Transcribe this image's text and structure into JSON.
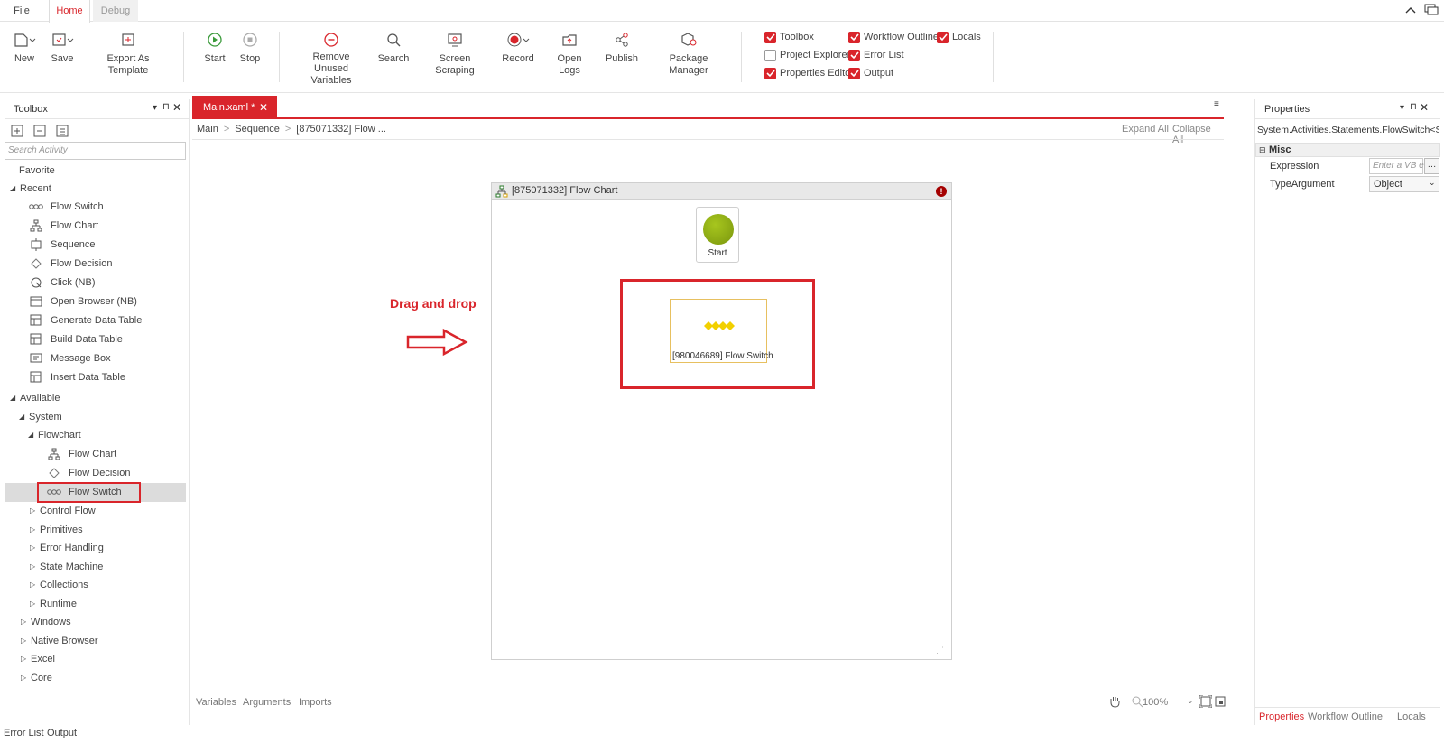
{
  "menu": {
    "tabs": [
      "File",
      "Home",
      "Debug"
    ]
  },
  "ribbon": {
    "buttons": {
      "new": "New",
      "save": "Save",
      "export": "Export As Template",
      "start": "Start",
      "stop": "Stop",
      "remove_unused_line1": "Remove Unused",
      "remove_unused_line2": "Variables",
      "search": "Search",
      "screen_scraping": "Screen Scraping",
      "record": "Record",
      "open_logs": "Open Logs",
      "publish": "Publish",
      "package_manager": "Package Manager"
    },
    "checks": [
      {
        "label": "Toolbox",
        "checked": true
      },
      {
        "label": "Workflow Outline",
        "checked": true
      },
      {
        "label": "Locals",
        "checked": true
      },
      {
        "label": "Project Explorer",
        "checked": false
      },
      {
        "label": "Error List",
        "checked": true
      },
      {
        "label": "Properties Editor",
        "checked": true
      },
      {
        "label": "Output",
        "checked": true
      }
    ]
  },
  "toolbox": {
    "title": "Toolbox",
    "search_placeholder": "Search Activity",
    "favorite": "Favorite",
    "recent": "Recent",
    "recent_items": [
      "Flow Switch",
      "Flow Chart",
      "Sequence",
      "Flow Decision",
      "Click (NB)",
      "Open Browser (NB)",
      "Generate Data Table",
      "Build Data Table",
      "Message Box",
      "Insert Data Table"
    ],
    "available": "Available",
    "system": "System",
    "flowchart": "Flowchart",
    "flowchart_items": [
      "Flow Chart",
      "Flow Decision",
      "Flow Switch"
    ],
    "system_groups": [
      "Control Flow",
      "Primitives",
      "Error Handling",
      "State Machine",
      "Collections",
      "Runtime"
    ],
    "top_groups": [
      "Windows",
      "Native Browser",
      "Excel",
      "Core"
    ]
  },
  "designer": {
    "tab_label": "Main.xaml *",
    "breadcrumb": [
      "Main",
      "Sequence",
      "[875071332] Flow ..."
    ],
    "expand_all": "Expand All",
    "collapse_all": "Collapse All",
    "flowchart_title": "[875071332] Flow Chart",
    "start_label": "Start",
    "switch_label": "[980046689] Flow Switch",
    "annotation": "Drag and drop",
    "zoom": "100%",
    "bottom_tabs": [
      "Variables",
      "Arguments",
      "Imports"
    ]
  },
  "properties": {
    "title": "Properties",
    "type_name": "System.Activities.Statements.FlowSwitch<S...",
    "category": "Misc",
    "rows": [
      {
        "name": "Expression",
        "placeholder": "Enter a VB e"
      },
      {
        "name": "TypeArgument",
        "value": "Object"
      }
    ],
    "bottom_tabs": [
      "Properties",
      "Workflow Outline",
      "Locals"
    ]
  },
  "status_tabs": [
    "Error List",
    "Output"
  ],
  "colors": {
    "accent": "#d9252b",
    "start_node": "#8aa91a",
    "switch_diamond": "#f2d000"
  }
}
